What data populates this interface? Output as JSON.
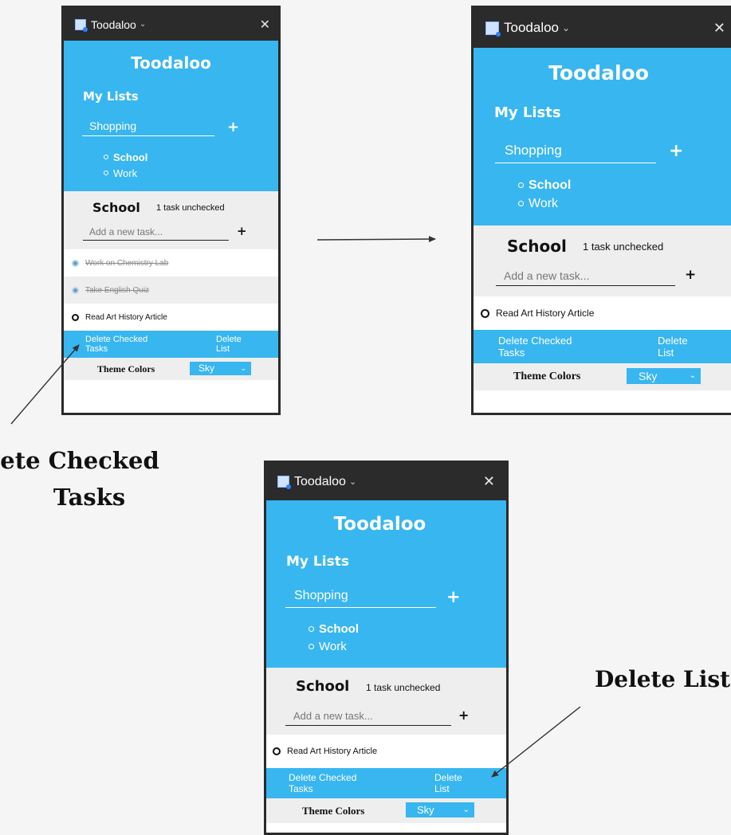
{
  "app": {
    "window_title": "Toodaloo",
    "app_title": "Toodaloo",
    "my_lists_label": "My Lists",
    "new_list_value": "Shopping",
    "add_list_symbol": "+",
    "close_symbol": "✕",
    "lists": [
      {
        "label": "School",
        "active": true
      },
      {
        "label": "Work",
        "active": false
      }
    ],
    "current_list": {
      "name": "School",
      "unchecked_label": "1 task unchecked",
      "task_placeholder": "Add a new task...",
      "add_task_symbol": "+"
    },
    "tasks_before": [
      {
        "label": "Work on Chemistry Lab",
        "checked": true
      },
      {
        "label": "Take English Quiz",
        "checked": true
      },
      {
        "label": "Read Art History Article",
        "checked": false
      }
    ],
    "tasks_after": [
      {
        "label": "Read Art History Article",
        "checked": false
      }
    ],
    "actions": {
      "delete_checked_line1": "Delete Checked",
      "delete_checked_line2": "Tasks",
      "delete_list_line1": "Delete",
      "delete_list_line2": "List"
    },
    "theme": {
      "label": "Theme Colors",
      "selected": "Sky"
    }
  },
  "annotations": {
    "left": {
      "line1": "ete Checked",
      "line2": "Tasks"
    },
    "right": {
      "line1": "Delete List"
    }
  },
  "colors": {
    "accent": "#38b6f0",
    "titlebar": "#2b2b2b",
    "section_bg": "#eeeeee",
    "page_bg": "#f5f5f5"
  }
}
